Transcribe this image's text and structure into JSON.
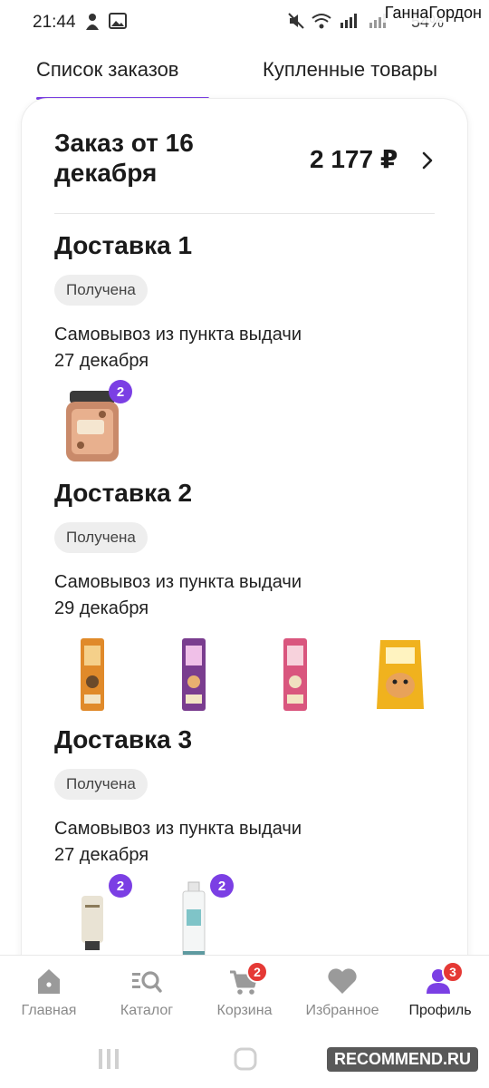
{
  "status_bar": {
    "time": "21:44",
    "battery": "54%",
    "watermark_user": "ГаннаГордон"
  },
  "tabs": [
    {
      "label": "Список заказов",
      "active": true
    },
    {
      "label": "Купленные товары",
      "active": false
    }
  ],
  "order": {
    "title": "Заказ от 16 декабря",
    "total": "2 177 ₽"
  },
  "deliveries": [
    {
      "title": "Доставка 1",
      "status": "Получена",
      "method": "Самовывоз из пункта выдачи",
      "date": "27 декабря",
      "products": [
        {
          "type": "jar",
          "qty": "2"
        }
      ]
    },
    {
      "title": "Доставка 2",
      "status": "Получена",
      "method": "Самовывоз из пункта выдачи",
      "date": "29 декабря",
      "products": [
        {
          "type": "stick-orange"
        },
        {
          "type": "stick-purple"
        },
        {
          "type": "stick-pink"
        },
        {
          "type": "bag-yellow"
        }
      ]
    },
    {
      "title": "Доставка 3",
      "status": "Получена",
      "method": "Самовывоз из пункта выдачи",
      "date": "27 декабря",
      "products": [
        {
          "type": "tube",
          "qty": "2"
        },
        {
          "type": "bottle",
          "qty": "2"
        }
      ]
    }
  ],
  "bottom_nav": [
    {
      "label": "Главная",
      "icon": "home-icon"
    },
    {
      "label": "Каталог",
      "icon": "catalog-search-icon"
    },
    {
      "label": "Корзина",
      "icon": "cart-icon",
      "badge": "2"
    },
    {
      "label": "Избранное",
      "icon": "heart-icon"
    },
    {
      "label": "Профиль",
      "icon": "profile-icon",
      "badge": "3",
      "active": true
    }
  ],
  "watermark_site": "RECOMMEND.RU",
  "colors": {
    "accent": "#7b3fe4",
    "badge_red": "#e53935",
    "chip_bg": "#eeeeee"
  }
}
